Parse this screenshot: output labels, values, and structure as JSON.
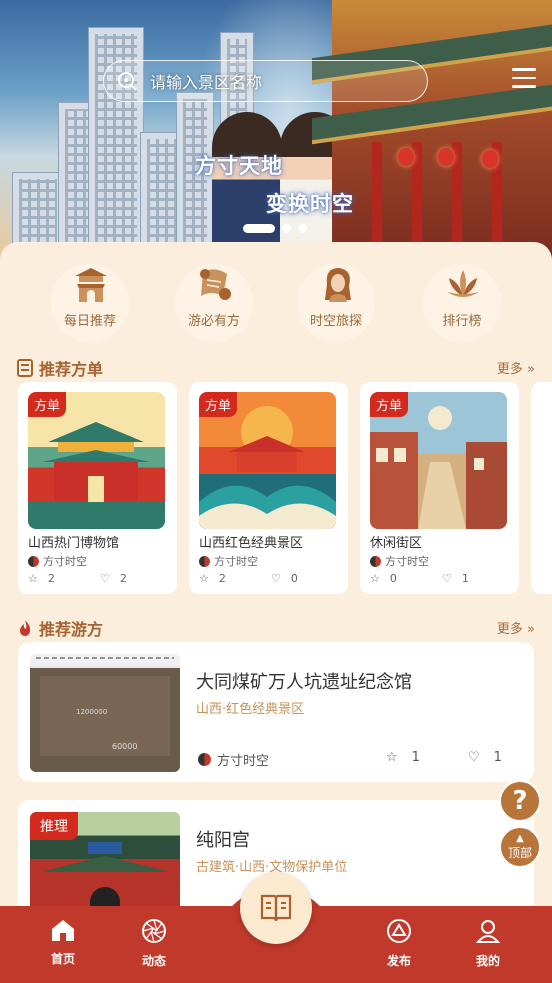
{
  "hero": {
    "search_placeholder": "请输入景区名称",
    "slogan_line1": "方寸天地",
    "slogan_line2": "变换时空",
    "carousel_pages": 3,
    "carousel_active": 1
  },
  "categories": [
    {
      "label": "每日推荐",
      "icon": "gate-tower-icon"
    },
    {
      "label": "游必有方",
      "icon": "scroll-icon"
    },
    {
      "label": "时空旅探",
      "icon": "traveler-portrait-icon"
    },
    {
      "label": "排行榜",
      "icon": "lotus-icon"
    }
  ],
  "sections": {
    "fangdan_title": "推荐方单",
    "youfang_title": "推荐游方",
    "more_label": "更多"
  },
  "fangdan": [
    {
      "tag": "方单",
      "name": "山西热门博物馆",
      "author": "方寸时空",
      "stars": "2",
      "likes": "2"
    },
    {
      "tag": "方单",
      "name": "山西红色经典景区",
      "author": "方寸时空",
      "stars": "2",
      "likes": "0"
    },
    {
      "tag": "方单",
      "name": "休闲街区",
      "author": "方寸时空",
      "stars": "0",
      "likes": "1"
    }
  ],
  "youfang": [
    {
      "title": "大同煤矿万人坑遗址纪念馆",
      "subtitle": "山西·红色经典景区",
      "author": "方寸时空",
      "stars": "1",
      "likes": "1",
      "tag": "",
      "image_text": "1200000",
      "image_text2": "60000"
    },
    {
      "title": "纯阳宫",
      "subtitle": "古建筑·山西·文物保护单位",
      "tag": "推理"
    }
  ],
  "fab": {
    "help": "?",
    "top_label": "顶部"
  },
  "tabs": [
    {
      "label": "首页",
      "icon": "home-icon"
    },
    {
      "label": "动态",
      "icon": "aperture-icon"
    },
    {
      "label": "",
      "icon": "book-icon"
    },
    {
      "label": "发布",
      "icon": "publish-triangle-icon"
    },
    {
      "label": "我的",
      "icon": "user-icon"
    }
  ],
  "colors": {
    "primary": "#c0392b",
    "accent": "#a8622f",
    "background": "#fbeedd",
    "tag": "#d42a1e"
  }
}
